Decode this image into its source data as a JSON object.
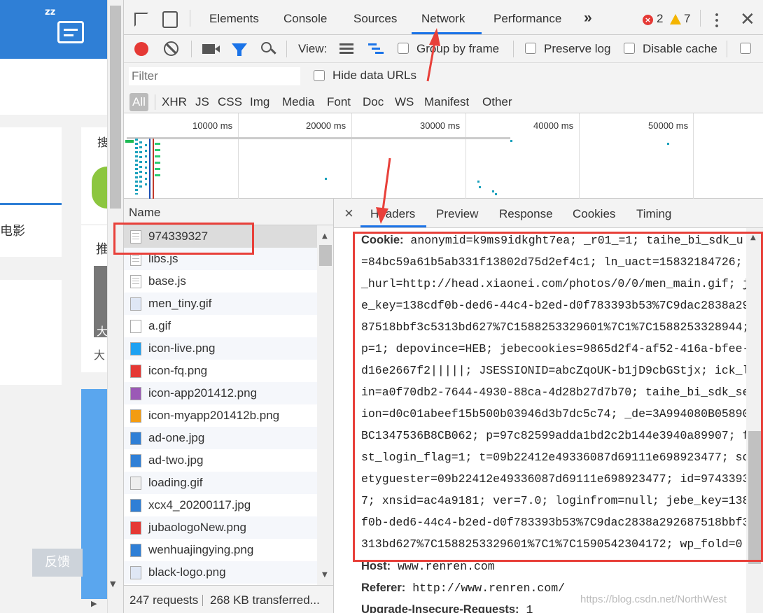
{
  "page": {
    "top_icon_zz": "zz",
    "movie_label": "电影",
    "push_label": "推",
    "search_label": "搜",
    "big_label_1": "大",
    "big_label_2": "大",
    "feedback_button": "反馈",
    "left_scroll_arrow_down": "▼",
    "left_scroll_arrow_right": "▶"
  },
  "devtools": {
    "tabs": [
      "Elements",
      "Console",
      "Sources",
      "Network",
      "Performance"
    ],
    "active_tab": "Network",
    "more_tabs": "»",
    "error_count": "2",
    "warning_count": "7",
    "toolbar": {
      "view_label": "View:",
      "group_by_frame": "Group by frame",
      "preserve_log": "Preserve log",
      "disable_cache": "Disable cache"
    },
    "filter": {
      "placeholder": "Filter",
      "hide_data_urls": "Hide data URLs"
    },
    "type_filters": [
      "All",
      "XHR",
      "JS",
      "CSS",
      "Img",
      "Media",
      "Font",
      "Doc",
      "WS",
      "Manifest",
      "Other"
    ],
    "active_type_filter": "All",
    "timeline_ticks": [
      "10000 ms",
      "20000 ms",
      "30000 ms",
      "40000 ms",
      "50000 ms"
    ],
    "list_header": "Name",
    "requests": [
      {
        "name": "974339327",
        "icon": "document-icon",
        "selected": true
      },
      {
        "name": "libs.js",
        "icon": "script-icon"
      },
      {
        "name": "base.js",
        "icon": "script-icon"
      },
      {
        "name": "men_tiny.gif",
        "icon": "image-icon"
      },
      {
        "name": "a.gif",
        "icon": "blank-image-icon"
      },
      {
        "name": "icon-live.png",
        "icon": "live-icon"
      },
      {
        "name": "icon-fq.png",
        "icon": "fq-icon"
      },
      {
        "name": "icon-app201412.png",
        "icon": "app-icon"
      },
      {
        "name": "icon-myapp201412b.png",
        "icon": "myapp-icon"
      },
      {
        "name": "ad-one.jpg",
        "icon": "jpg-icon"
      },
      {
        "name": "ad-two.jpg",
        "icon": "jpg-icon"
      },
      {
        "name": "loading.gif",
        "icon": "loading-icon"
      },
      {
        "name": "xcx4_20200117.jpg",
        "icon": "jpg-icon"
      },
      {
        "name": "jubaologoNew.png",
        "icon": "report-logo-icon"
      },
      {
        "name": "wenhuajingying.png",
        "icon": "culture-icon"
      },
      {
        "name": "black-logo.png",
        "icon": "image-icon"
      }
    ],
    "status_bar": {
      "requests": "247 requests",
      "transferred": "268 KB transferred..."
    },
    "detail_tabs": [
      "Headers",
      "Preview",
      "Response",
      "Cookies",
      "Timing"
    ],
    "active_detail_tab": "Headers",
    "close_detail": "×",
    "cookie_key": "Cookie:",
    "cookie_lines": [
      "anonymid=k9ms9idkght7ea; _r01_=1; taihe_bi_sdk_u",
      "=84bc59a61b5ab331f13802d75d2ef4c1; ln_uact=15832184726;",
      "_hurl=http://head.xiaonei.com/photos/0/0/men_main.gif; j",
      "e_key=138cdf0b-ded6-44c4-b2ed-d0f783393b53%7C9dac2838a29",
      "87518bbf3c5313bd627%7C1588253329601%7C1%7C1588253328944;",
      "p=1; depovince=HEB; jebecookies=9865d2f4-af52-416a-bfee-",
      "d16e2667f2|||||; JSESSIONID=abcZqoUK-b1jD9cbGStjx; ick_l",
      "in=a0f70db2-7644-4930-88ca-4d28b27d7b70; taihe_bi_sdk_se",
      "ion=d0c01abeef15b500b03946d3b7dc5c74; _de=3A994080B05890",
      "BC1347536B8CB062; p=97c82599adda1bd2c2b144e3940a89907; f",
      "st_login_flag=1; t=09b22412e49336087d69111e698923477; sc",
      "etyguester=09b22412e49336087d69111e698923477; id=9743393",
      "7; xnsid=ac4a9181; ver=7.0; loginfrom=null; jebe_key=138",
      "f0b-ded6-44c4-b2ed-d0f783393b53%7C9dac2838a292687518bbf3",
      "313bd627%7C1588253329601%7C1%7C1590542304172; wp_fold=0"
    ],
    "host_key": "Host:",
    "host_value": "www.renren.com",
    "referer_key": "Referer:",
    "referer_value": "http://www.renren.com/",
    "upgrade_key": "Upgrade-Insecure-Requests:",
    "upgrade_value": "1",
    "watermark": "https://blog.csdn.net/NorthWest"
  },
  "colors": {
    "annotation_red": "#e8403a",
    "accent_blue": "#1a73e8",
    "record_red": "#e53935",
    "page_blue": "#2f7fd6"
  }
}
